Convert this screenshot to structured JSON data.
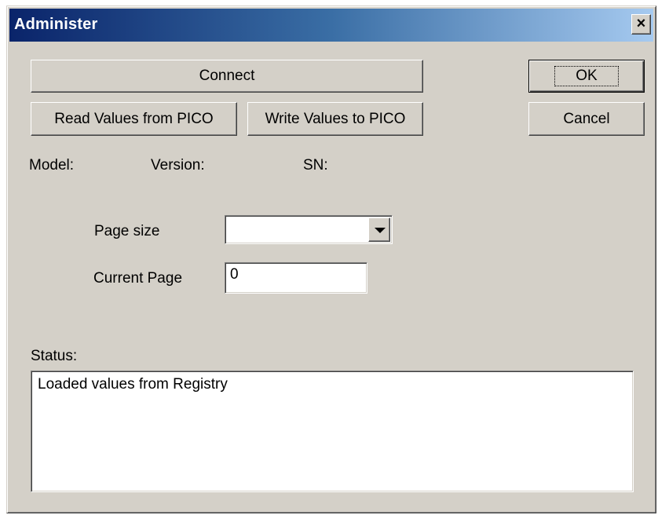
{
  "window": {
    "title": "Administer",
    "close_label": "×"
  },
  "buttons": {
    "connect": "Connect",
    "read_values": "Read Values from PICO",
    "write_values": "Write Values to PICO",
    "ok": "OK",
    "cancel": "Cancel"
  },
  "info": {
    "model_label": "Model:",
    "version_label": "Version:",
    "sn_label": "SN:"
  },
  "fields": {
    "page_size_label": "Page size",
    "page_size_value": "",
    "current_page_label": "Current Page",
    "current_page_value": "0"
  },
  "status": {
    "label": "Status:",
    "text": "Loaded values from Registry"
  },
  "icons": {
    "close": "close-icon",
    "dropdown": "chevron-down-icon"
  },
  "colors": {
    "face": "#d4d0c8",
    "title_start": "#0a246a",
    "title_end": "#a6caf0"
  }
}
